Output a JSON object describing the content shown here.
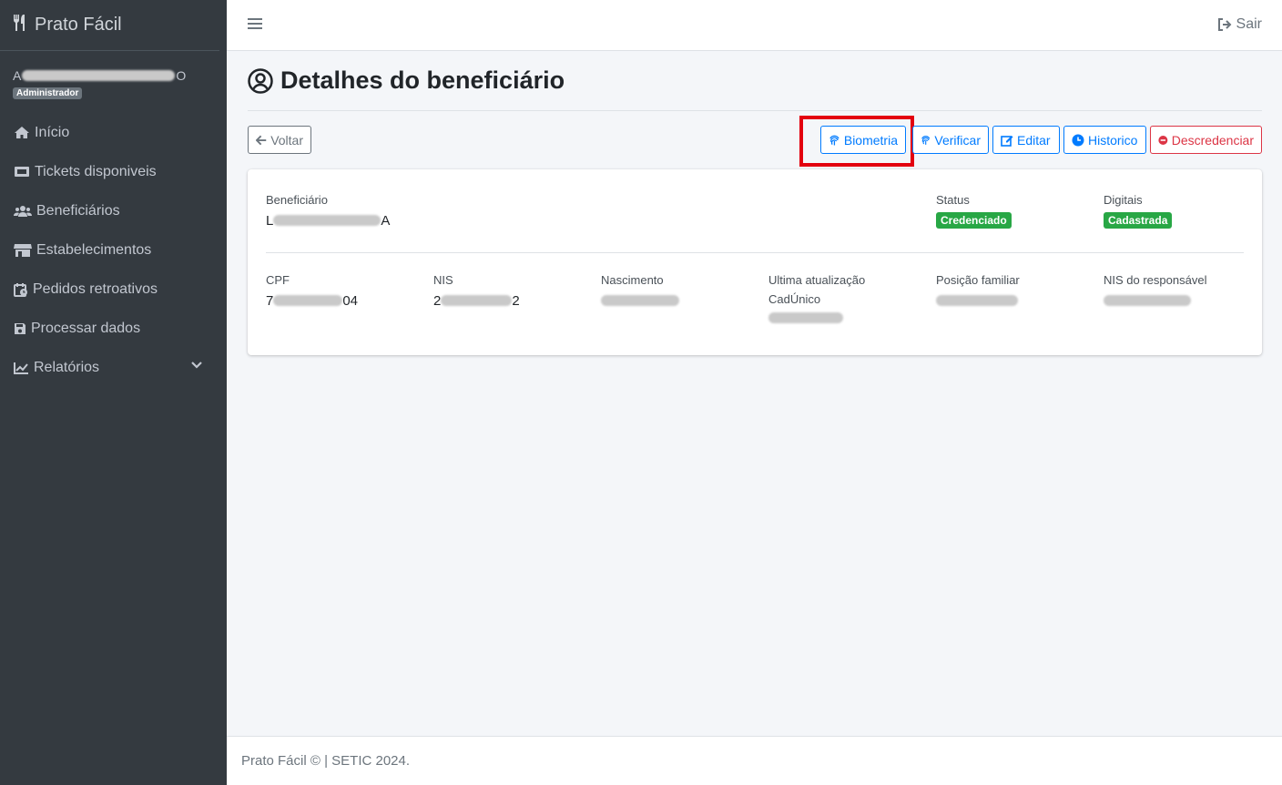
{
  "app": {
    "brand": "Prato Fácil"
  },
  "user": {
    "name_start": "A",
    "name_end": "O",
    "role": "Administrador"
  },
  "sidebar": {
    "items": [
      {
        "label": "Início",
        "icon": "home-icon"
      },
      {
        "label": "Tickets disponiveis",
        "icon": "ticket-icon"
      },
      {
        "label": "Beneficiários",
        "icon": "users-icon"
      },
      {
        "label": "Estabelecimentos",
        "icon": "store-icon"
      },
      {
        "label": "Pedidos retroativos",
        "icon": "calendar-clock-icon"
      },
      {
        "label": "Processar dados",
        "icon": "save-icon"
      },
      {
        "label": "Relatórios",
        "icon": "chart-line-icon"
      }
    ]
  },
  "topbar": {
    "logout_label": "Sair"
  },
  "page": {
    "title": "Detalhes do beneficiário"
  },
  "actions": {
    "back": "Voltar",
    "biometria": "Biometria",
    "verificar": "Verificar",
    "editar": "Editar",
    "historico": "Historico",
    "descredenciar": "Descredenciar"
  },
  "details": {
    "beneficiario_label": "Beneficiário",
    "beneficiario_start": "L",
    "beneficiario_end": "A",
    "status_label": "Status",
    "status_value": "Credenciado",
    "digitais_label": "Digitais",
    "digitais_value": "Cadastrada",
    "cpf_label": "CPF",
    "cpf_start": "7",
    "cpf_end": "04",
    "nis_label": "NIS",
    "nis_start": "2",
    "nis_end": "2",
    "nascimento_label": "Nascimento",
    "ultima_label": "Ultima atualização",
    "ultima_sub": "CadÚnico",
    "posicao_label": "Posição familiar",
    "nis_resp_label": "NIS do responsável"
  },
  "footer": {
    "text": "Prato Fácil © | SETIC 2024."
  },
  "colors": {
    "primary": "#007bff",
    "danger": "#dc3545",
    "success": "#28a745",
    "sidebar": "#343a40",
    "highlight": "#e3000f"
  }
}
